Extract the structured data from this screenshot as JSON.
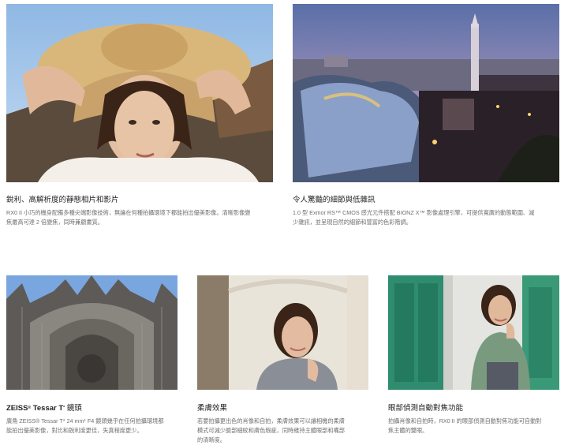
{
  "features": [
    {
      "title": "銳利、高解析度的靜態相片和影片",
      "description": "RX0 II 小巧的機身配備多種尖端影像技術，無論在何種拍攝環境下都能拍出優美影像。清晰影像變焦最高可達 2 倍變焦，同時兼顧畫質。",
      "image": "portrait-woman-straw-hat"
    },
    {
      "title": "令人驚豔的細節與低雜訊",
      "description": "1.0 型 Exmor RS™ CMOS 感光元件搭配 BIONZ X™ 影像處理引擎，可提供寬廣的動態範圍、減少雜訊，並呈現自然的細節和豐富的色彩階調。",
      "image": "park-guell-dusk"
    },
    {
      "title_main": "ZEISS",
      "title_reg": "®",
      "title_model": " Tessar T",
      "title_star": "*",
      "title_end": " 鏡頭",
      "description": "廣角 ZEISS® Tessar T* 24 mm¹ F4 鏡頭幾乎在任何拍攝環境都能拍出優美影像，對比和銳利度更佳，失真程度更少。",
      "image": "cathedral-facade"
    },
    {
      "title": "柔膚效果",
      "description": "若要拍攝更出色的肖像和自拍，柔膚效果可以讓相機的柔膚模式可減少臉部細紋和膚色瑕疵，同時維持主體眼部和嘴部的清晰度。",
      "image": "woman-pillar-selfie"
    },
    {
      "title": "眼部偵測自動對焦功能",
      "description": "拍攝肖像和自拍時，RX0 II 的眼部偵測自動對焦功能可自動對焦主體的雙眼。",
      "image": "woman-green-doors"
    }
  ]
}
